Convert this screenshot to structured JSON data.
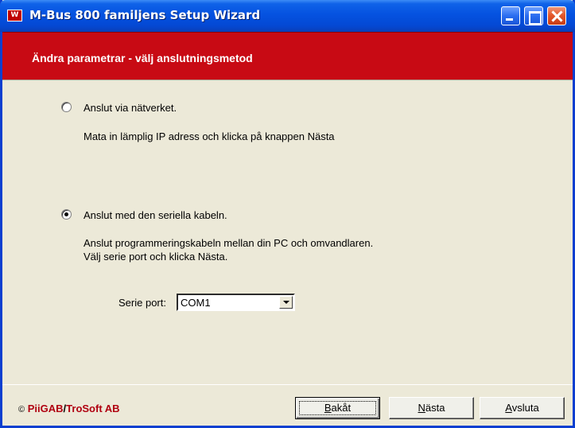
{
  "window": {
    "icon_text": "W",
    "title": "M-Bus 800 familjens Setup Wizard"
  },
  "header": {
    "title": "Ändra parametrar - välj anslutningsmetod"
  },
  "options": [
    {
      "label": "Anslut via nätverket.",
      "selected": false,
      "help": [
        "Mata in lämplig IP adress och klicka på knappen Nästa"
      ]
    },
    {
      "label": "Anslut med den seriella kabeln.",
      "selected": true,
      "help": [
        "Anslut programmeringskabeln mellan din PC och omvandlaren.",
        "Välj serie port och klicka Nästa."
      ]
    }
  ],
  "serial_port": {
    "label": "Serie port:",
    "value": "COM1"
  },
  "footer": {
    "copyright_symbol": "©",
    "company_a": "PiiGAB",
    "slash": "/",
    "company_b": "TroSoft AB"
  },
  "buttons": {
    "back": {
      "mnemonic": "B",
      "rest": "akåt"
    },
    "next": {
      "mnemonic": "N",
      "rest": "ästa"
    },
    "exit": {
      "mnemonic": "A",
      "rest": "vsluta"
    }
  },
  "colors": {
    "header_band": "#c80a14",
    "titlebar": "#0552e0",
    "brand_text": "#b00010"
  }
}
